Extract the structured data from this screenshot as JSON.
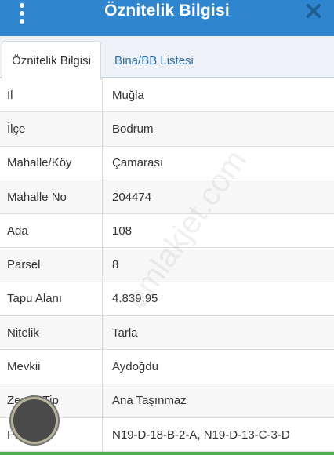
{
  "header": {
    "title": "Öznitelik Bilgisi",
    "menu_icon": "vertical-dots-icon",
    "close_icon": "close-icon"
  },
  "tabs": [
    {
      "label": "Öznitelik Bilgisi",
      "active": true
    },
    {
      "label": "Bina/BB Listesi",
      "active": false
    }
  ],
  "rows": [
    {
      "label": "İl",
      "value": "Muğla"
    },
    {
      "label": "İlçe",
      "value": "Bodrum"
    },
    {
      "label": "Mahalle/Köy",
      "value": "Çamarası"
    },
    {
      "label": "Mahalle No",
      "value": "204474"
    },
    {
      "label": "Ada",
      "value": "108"
    },
    {
      "label": "Parsel",
      "value": "8"
    },
    {
      "label": "Tapu Alanı",
      "value": "4.839,95"
    },
    {
      "label": "Nitelik",
      "value": "Tarla"
    },
    {
      "label": "Mevkii",
      "value": "Aydoğdu"
    },
    {
      "label": "Zemin Tip",
      "value": "Ana Taşınmaz"
    },
    {
      "label": "Pafta",
      "value": "N19-D-18-B-2-A, N19-D-13-C-3-D"
    }
  ],
  "watermark": "emlakjet.com",
  "colors": {
    "header": "#2f86cf",
    "tab_inactive_text": "#2d6ea8",
    "bottom_bar": "#4caf50"
  }
}
